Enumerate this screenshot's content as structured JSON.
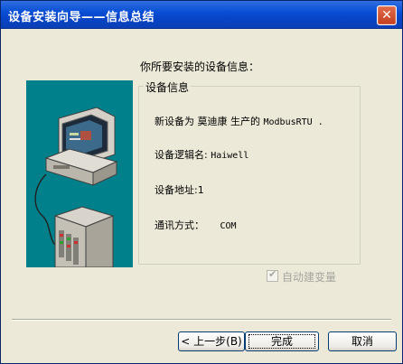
{
  "window": {
    "title": "设备安装向导——信息总结",
    "close_glyph": "✕"
  },
  "prompt": "你所要安装的设备信息：",
  "group": {
    "title": "设备信息",
    "lines": {
      "new_device_prefix": "新设备为 莫迪康 生产的",
      "new_device_protocol": "ModbusRTU",
      "new_device_suffix": " .",
      "logical_name_label": "设备逻辑名:",
      "logical_name_value": "Haiwell",
      "address_label": "设备地址:",
      "address_value": "1",
      "comm_label": "通讯方式：",
      "comm_value": "COM"
    }
  },
  "options": {
    "auto_create_vars_label": "自动建变量",
    "auto_create_vars_checked": true,
    "auto_create_vars_enabled": false
  },
  "buttons": {
    "back": "< 上一步(B)",
    "finish": "完成",
    "cancel": "取消"
  },
  "colors": {
    "titlebar": "#0a4fd6",
    "dialog_bg": "#ece9d8",
    "illustration_bg": "#00808a"
  },
  "icons": {
    "close": "close-icon",
    "illustration": "computer-plc-illustration",
    "checkbox": "checkmark-icon"
  }
}
